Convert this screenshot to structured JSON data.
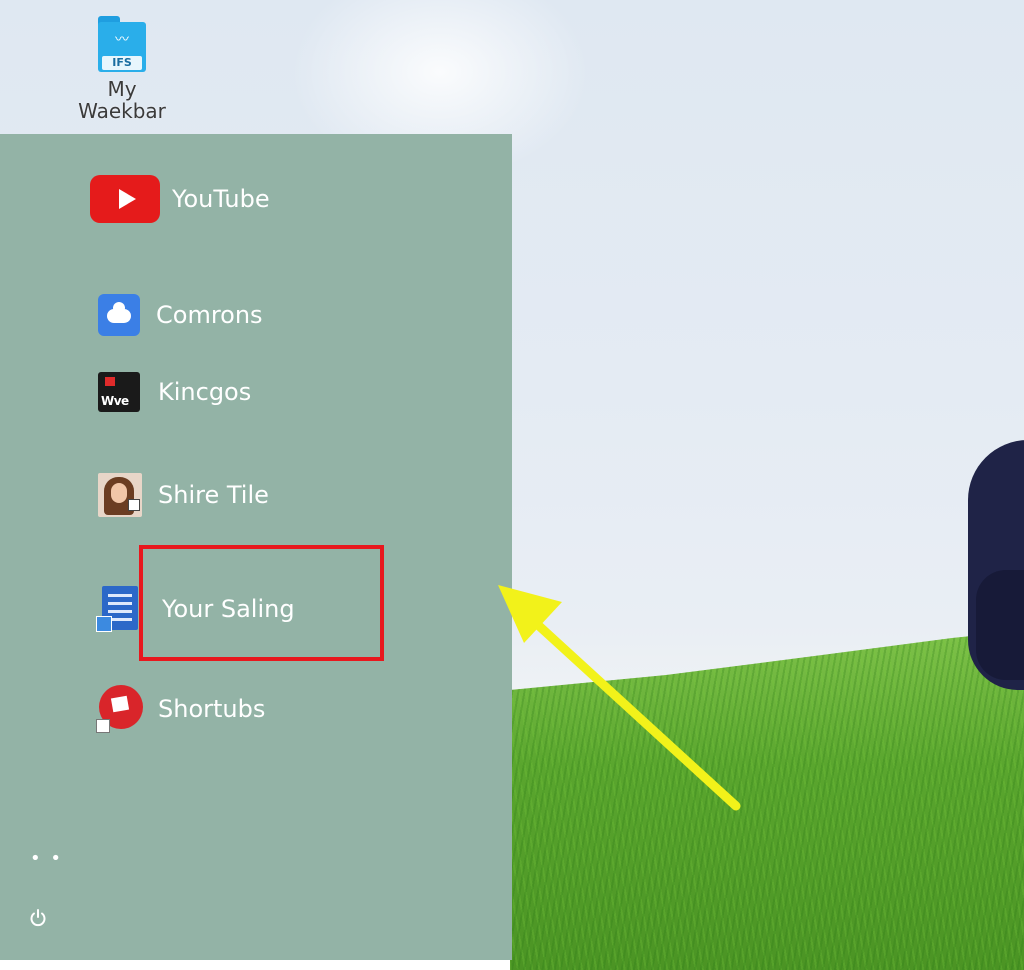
{
  "desktop": {
    "icon_tag": "IFS",
    "icon_label_line1": "My",
    "icon_label_line2": "Waekbar"
  },
  "start_menu": {
    "items": [
      {
        "label": "YouTube",
        "icon": "youtube-icon"
      },
      {
        "label": "Comrons",
        "icon": "cloud-icon"
      },
      {
        "label": "Kincgos",
        "icon": "kincgos-app-icon",
        "icon_text": "Wve"
      },
      {
        "label": "Shire Tile",
        "icon": "profile-photo-icon"
      },
      {
        "label": "Your Saling",
        "icon": "document-icon"
      },
      {
        "label": "Shortubs",
        "icon": "shortcut-icon"
      }
    ],
    "more_glyph": "• •",
    "power_icon": "power-icon"
  },
  "annotations": {
    "highlight_color": "#e8171d",
    "arrow_color": "#f2f21a"
  },
  "colors": {
    "panel_bg": "#93b3a6",
    "youtube_red": "#e51b1b"
  }
}
